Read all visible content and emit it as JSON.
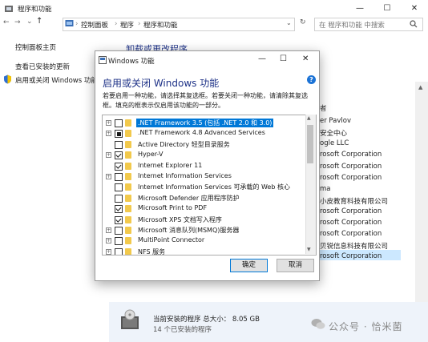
{
  "bg_window": {
    "title": "程序和功能",
    "controls": {
      "minimize": "—",
      "maximize": "☐",
      "close": "✕"
    },
    "breadcrumb": [
      "控制面板",
      "程序",
      "程序和功能"
    ],
    "search_placeholder": "在 程序和功能 中搜索",
    "sidebar": [
      "控制面板主页",
      "查看已安装的更新",
      "启用或关闭 Windows 功能"
    ],
    "partial_heading": "卸载或更改程序",
    "column_header": "者",
    "publishers": [
      "er Pavlov",
      "安全中心",
      "ogle LLC",
      "rosoft Corporation",
      "rosoft Corporation",
      "rosoft Corporation",
      "ma",
      "小皮教育科技有限公司",
      "rosoft Corporation",
      "rosoft Corporation",
      "rosoft Corporation",
      "贝锐信息科技有限公司",
      "rosoft Corporation"
    ],
    "bottom": {
      "line1": "当前安装的程序  总大小：  8.05 GB",
      "line2": "14 个已安装的程序"
    },
    "watermark": "公众号 · 恰米菌"
  },
  "dialog": {
    "title": "Windows 功能",
    "controls": {
      "minimize": "—",
      "maximize": "☐",
      "close": "✕"
    },
    "heading": "启用或关闭 Windows 功能",
    "help": "?",
    "description": "若要启用一种功能，请选择其复选框。若要关闭一种功能，请清除其复选框。填充的框表示仅启用该功能的一部分。",
    "features": [
      {
        "label": ".NET Framework 3.5 (包括 .NET 2.0 和 3.0)",
        "expandable": true,
        "state": "unchecked",
        "selected": true
      },
      {
        "label": ".NET Framework 4.8 Advanced Services",
        "expandable": true,
        "state": "partial",
        "selected": false
      },
      {
        "label": "Active Directory 轻型目录服务",
        "expandable": false,
        "state": "unchecked",
        "selected": false
      },
      {
        "label": "Hyper-V",
        "expandable": true,
        "state": "checked",
        "selected": false
      },
      {
        "label": "Internet Explorer 11",
        "expandable": false,
        "state": "checked",
        "selected": false
      },
      {
        "label": "Internet Information Services",
        "expandable": true,
        "state": "unchecked",
        "selected": false
      },
      {
        "label": "Internet Information Services 可承载的 Web 核心",
        "expandable": false,
        "state": "unchecked",
        "selected": false
      },
      {
        "label": "Microsoft Defender 应用程序防护",
        "expandable": false,
        "state": "unchecked",
        "selected": false
      },
      {
        "label": "Microsoft Print to PDF",
        "expandable": false,
        "state": "checked",
        "selected": false
      },
      {
        "label": "Microsoft XPS 文档写入程序",
        "expandable": false,
        "state": "checked",
        "selected": false
      },
      {
        "label": "Microsoft 消息队列(MSMQ)服务器",
        "expandable": true,
        "state": "unchecked",
        "selected": false
      },
      {
        "label": "MultiPoint Connector",
        "expandable": true,
        "state": "unchecked",
        "selected": false
      },
      {
        "label": "NFS 服务",
        "expandable": true,
        "state": "unchecked",
        "selected": false
      }
    ],
    "ok_label": "确定",
    "cancel_label": "取消"
  }
}
